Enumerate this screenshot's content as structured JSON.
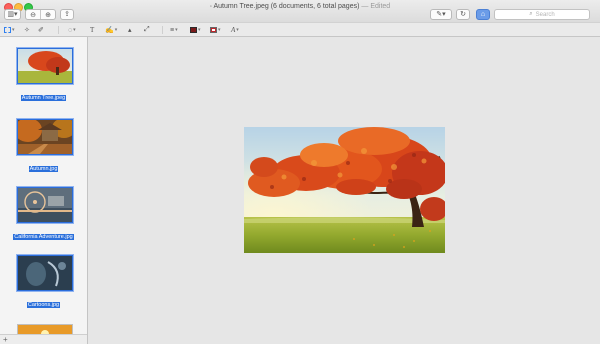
{
  "window": {
    "title": "Autumn Tree.jpeg (6 documents, 6 total pages)",
    "title_separator": "—",
    "edited_label": "Edited"
  },
  "toolbar": {
    "search_placeholder": "Search",
    "sidebar_icon": "sidebar-icon",
    "zoom_out_icon": "zoom-out-icon",
    "zoom_in_icon": "zoom-in-icon",
    "share_icon": "share-icon",
    "markup_icon": "pen-icon",
    "rotate_icon": "rotate-icon",
    "toolbox_icon": "toolbox-icon"
  },
  "markup_tools": [
    "rectangular-selection-icon",
    "instant-alpha-icon",
    "sketch-icon",
    "shapes-icon",
    "text-icon",
    "sign-icon",
    "adjust-color-icon",
    "adjust-size-icon",
    "shape-style-icon",
    "border-color-icon",
    "fill-color-icon",
    "text-style-icon"
  ],
  "colors": {
    "selection": "#2a6fdb",
    "border_color": "#2b2b2b",
    "fill_color": "#c0272d"
  },
  "sidebar": {
    "items": [
      {
        "label": "Autumn Tree.jpeg",
        "selected": true
      },
      {
        "label": "Autumn.jpg",
        "selected": true
      },
      {
        "label": "California Adventure.jpg",
        "selected": true
      },
      {
        "label": "Cartoons.jpg",
        "selected": true
      },
      {
        "label": "",
        "selected": false
      }
    ]
  }
}
